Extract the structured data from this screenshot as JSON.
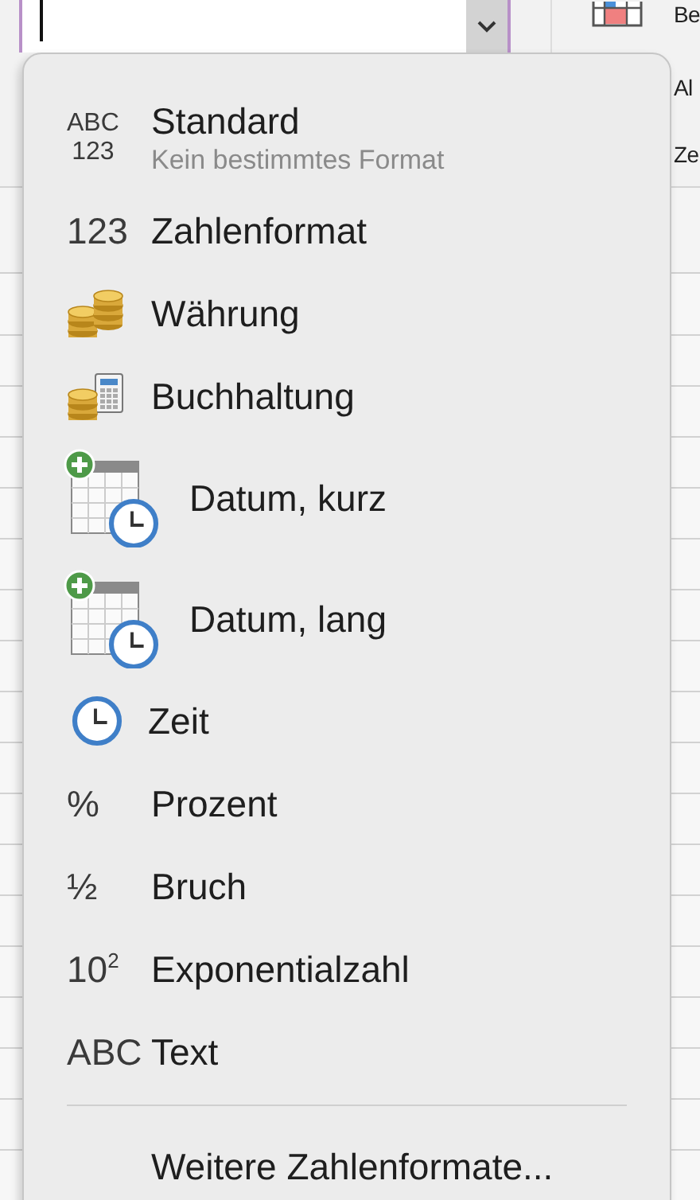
{
  "formula_bar": {
    "has_dropdown": true
  },
  "ribbon": {
    "items": [
      {
        "kind": "table",
        "label": "Be"
      },
      {
        "kind": "none",
        "label": "Al"
      },
      {
        "kind": "none",
        "label": "Ze"
      }
    ]
  },
  "menu": {
    "items": [
      {
        "kind": "glyph-stack",
        "symbol_lines": [
          "ABC",
          "123"
        ],
        "label": "Standard",
        "description": "Kein bestimmtes Format"
      },
      {
        "kind": "glyph",
        "symbol": "123",
        "label": "Zahlenformat"
      },
      {
        "kind": "coins",
        "label": "Währung"
      },
      {
        "kind": "coins-calculator",
        "label": "Buchhaltung"
      },
      {
        "kind": "calendar-clock",
        "label": "Datum, kurz"
      },
      {
        "kind": "calendar-clock",
        "label": "Datum, lang"
      },
      {
        "kind": "clock",
        "label": "Zeit"
      },
      {
        "kind": "glyph",
        "symbol": "%",
        "label": "Prozent"
      },
      {
        "kind": "glyph",
        "symbol": "½",
        "label": "Bruch"
      },
      {
        "kind": "glyph",
        "symbol": "10$^{2}$",
        "label": "Exponentialzahl"
      },
      {
        "kind": "glyph",
        "symbol": "ABC",
        "label": "Text"
      },
      {
        "kind": "separator"
      },
      {
        "kind": "plain",
        "label": "Weitere Zahlenformate..."
      }
    ]
  }
}
